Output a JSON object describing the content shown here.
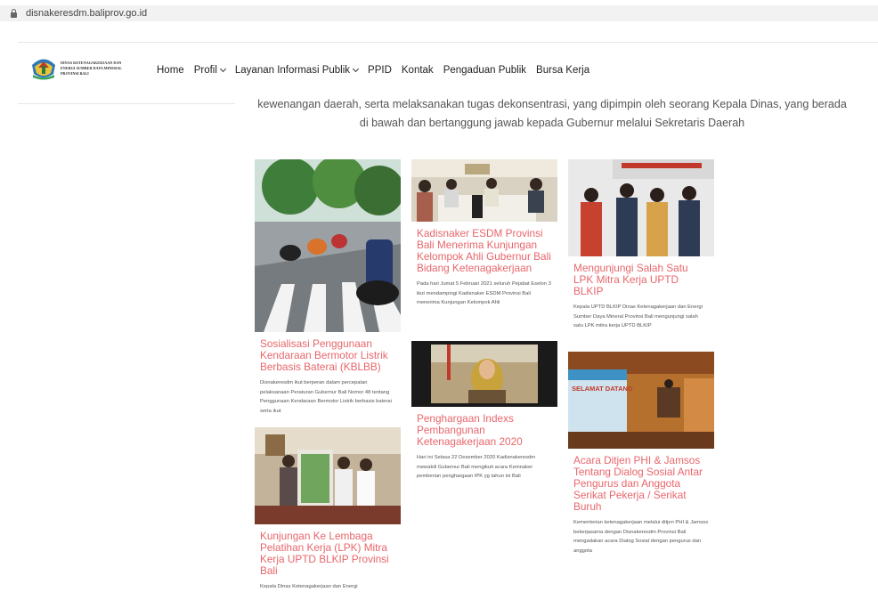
{
  "browser": {
    "url": "disnakeresdm.baliprov.go.id"
  },
  "header": {
    "logo_lines": [
      "DINAS KETENAGAKERJAAN DAN",
      "ENERGI SUMBER DAYA MINERAL",
      "PROVINSI BALI"
    ],
    "nav": [
      {
        "label": "Home",
        "dropdown": false
      },
      {
        "label": "Profil",
        "dropdown": true
      },
      {
        "label": "Layanan Informasi Publik",
        "dropdown": true
      },
      {
        "label": "PPID",
        "dropdown": false
      },
      {
        "label": "Kontak",
        "dropdown": false
      },
      {
        "label": "Pengaduan Publik",
        "dropdown": false
      },
      {
        "label": "Bursa Kerja",
        "dropdown": false
      }
    ]
  },
  "intro": {
    "line1": "kewenangan daerah, serta melaksanakan tugas dekonsentrasi, yang dipimpin oleh seorang Kepala Dinas, yang berada",
    "line2": "di bawah dan bertanggung jawab kepada Gubernur melalui Sekretaris Daerah"
  },
  "posts": [
    {
      "title": "Sosialisasi Penggunaan Kendaraan Bermotor Listrik Berbasis Baterai (KBLBB)",
      "excerpt": "Disnakeresdm ikut berperan dalam percepatan pelaksanaan Peraturan Gubernur Bali Nomor 48 tentang Penggunaan Kendaraan Bermotor Listrik berbasis baterai serta ikut"
    },
    {
      "title": "Kunjungan Ke Lembaga Pelatihan Kerja (LPK) Mitra Kerja UPTD BLKIP Provinsi Bali",
      "excerpt": "Kepala Dinas Ketenagakerjaan dan Energi"
    },
    {
      "title": "Kadisnaker ESDM Provinsi Bali Menerima Kunjungan Kelompok Ahli Gubernur Bali Bidang Ketenagakerjaan",
      "excerpt": "Pada hari Jumat 5 Februari 2021 seluruh Pejabat Eselon 3 ikut mendampingi Kadisnaker ESDM Provinsi Bali menerima Kunjungan Kelompok Ahli"
    },
    {
      "title": "Penghargaan Indexs Pembangunan Ketenagakerjaan 2020",
      "excerpt": "Hari ini Selasa 22 Desember 2020 Kadisnakeresdm mewakili Gubernur Bali mengikuti acara Kemnaker pemberian penghargaan IPK yg tahun ini Bali"
    },
    {
      "title": "Mengunjungi Salah Satu LPK Mitra Kerja UPTD BLKIP",
      "excerpt": "Kepala UPTD BLKIP Dinas Ketenagakerjaan dan Energi Sumber Daya Mineral Provinsi Bali mengunjungi salah satu LPK mitra kerja UPTD BLKIP"
    },
    {
      "title": "Acara Ditjen PHI & Jamsos Tentang Dialog Sosial Antar Pengurus dan Anggota Serikat Pekerja / Serikat Buruh",
      "excerpt": "Kementerian ketenagakerjaan melalui ditjen PHI & Jamsos bekerjasama dengan Disnakeresdm Provinsi Bali mengadakan acara Dialog Sosial dengan pengurus dan anggota"
    }
  ],
  "photo_text": {
    "welcome_sign": "SELAMAT DATANG"
  },
  "colors": {
    "post_title": "#e8666b",
    "text": "#555555",
    "url_bar": "#f2f2f2"
  }
}
